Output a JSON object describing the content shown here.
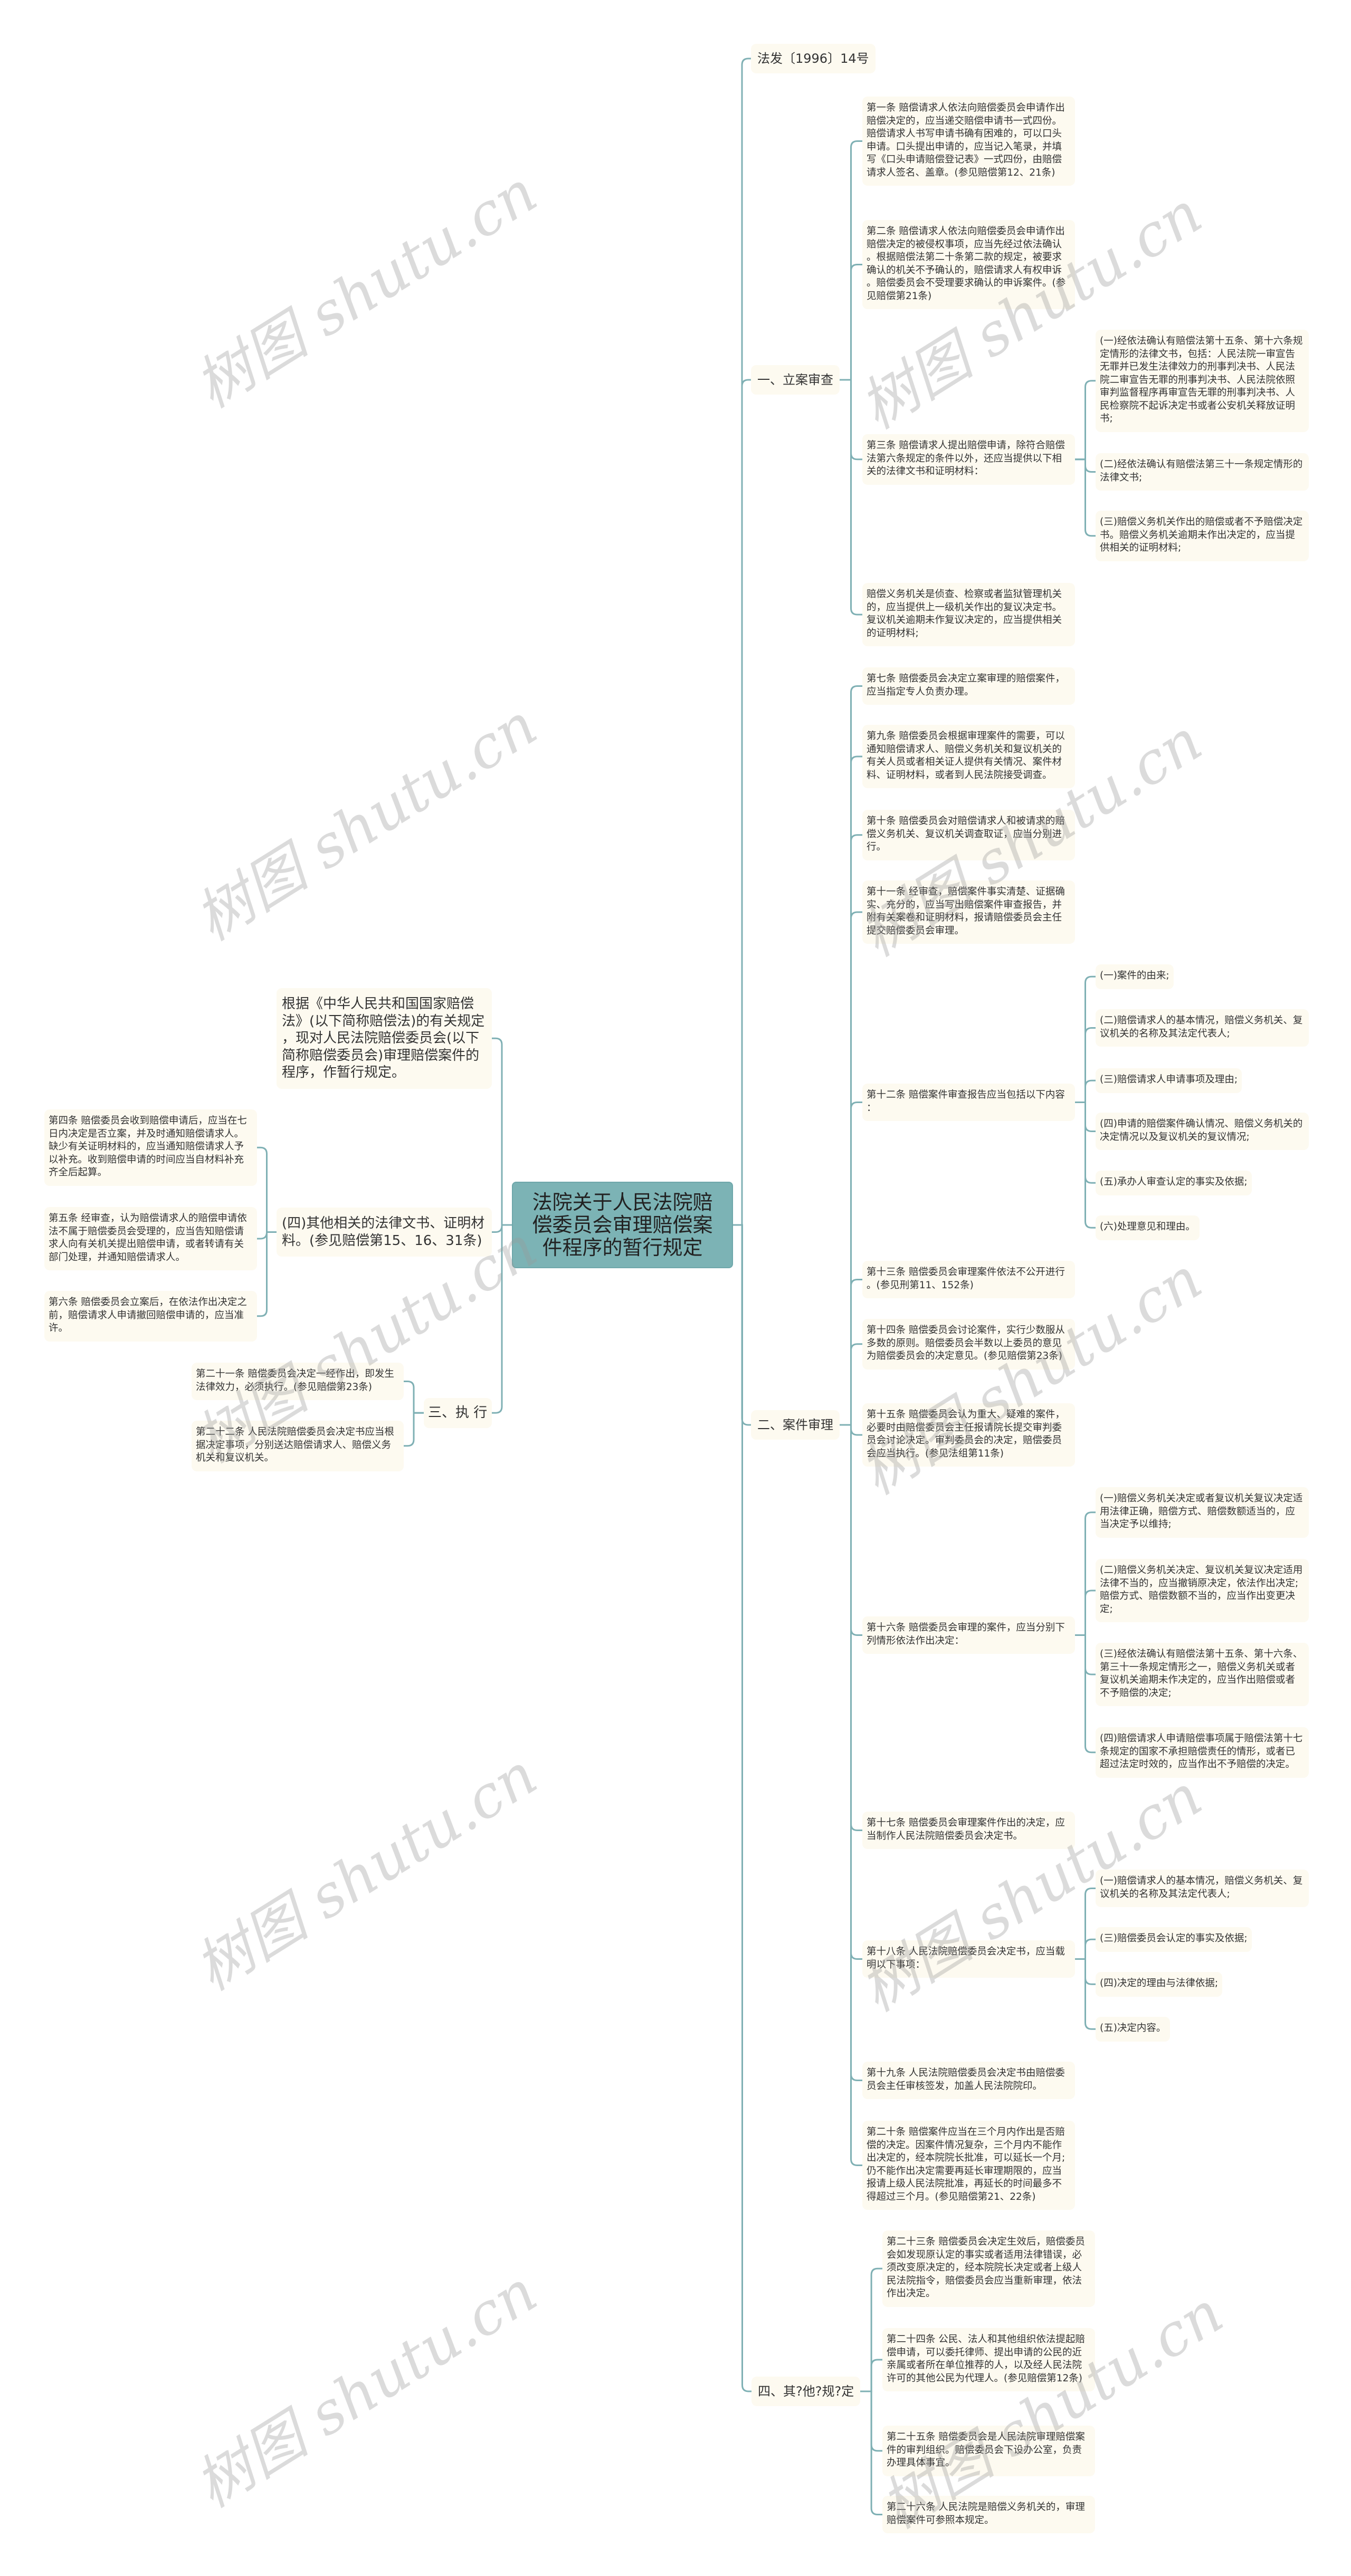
{
  "title": "法院关于人民法院赔偿委员会审理赔偿案件程序的暂行规定",
  "colors": {
    "root_fill": "#7cb3b5",
    "line": "#7fb0b4",
    "node_fill": "#fdfaf0"
  },
  "watermark": "树图 shutu.cn",
  "left": {
    "intro": "根据《中华人民共和国国家赔偿法》(以下简称赔偿法)的有关规定，现对人民法院赔偿委员会(以下简称赔偿委员会)审理赔偿案件的程序，作暂行规定。",
    "other_docs": {
      "label": "(四)其他相关的法律文书、证明材料。(参见赔偿第15、16、31条)",
      "items": [
        "第四条 赔偿委员会收到赔偿申请后，应当在七日内决定是否立案，并及时通知赔偿请求人。缺少有关证明材料的，应当通知赔偿请求人予以补充。收到赔偿申请的时间应当自材料补充齐全后起算。",
        "第五条 经审查，认为赔偿请求人的赔偿申请依法不属于赔偿委员会受理的，应当告知赔偿请求人向有关机关提出赔偿申请，或者转请有关部门处理，并通知赔偿请求人。",
        "第六条 赔偿委员会立案后，在依法作出决定之前，赔偿请求人申请撤回赔偿申请的，应当准许。"
      ]
    },
    "execution": {
      "label": "三、执 行",
      "items": [
        "第二十一条 赔偿委员会决定一经作出，即发生法律效力，必须执行。(参见赔偿第23条)",
        "第二十二条 人民法院赔偿委员会决定书应当根据决定事项，分别送达赔偿请求人、赔偿义务机关和复议机关。"
      ]
    }
  },
  "right": {
    "doc_number": "法发〔1996〕14号",
    "filing": {
      "label": "一、立案审查",
      "items": [
        {
          "text": "第一条 赔偿请求人依法向赔偿委员会申请作出赔偿决定的，应当递交赔偿申请书一式四份。赔偿请求人书写申请书确有困难的，可以口头申请。口头提出申请的，应当记入笔录，并填写《口头申请赔偿登记表》一式四份，由赔偿请求人签名、盖章。(参见赔偿第12、21条)"
        },
        {
          "text": "第二条 赔偿请求人依法向赔偿委员会申请作出赔偿决定的被侵权事项，应当先经过依法确认。根据赔偿法第二十条第二款的规定，被要求确认的机关不予确认的，赔偿请求人有权申诉。赔偿委员会不受理要求确认的申诉案件。(参见赔偿第21条)"
        },
        {
          "text": "第三条 赔偿请求人提出赔偿申请，除符合赔偿法第六条规定的条件以外，还应当提供以下相关的法律文书和证明材料：",
          "sub": [
            "(一)经依法确认有赔偿法第十五条、第十六条规定情形的法律文书，包括：人民法院一审宣告无罪并已发生法律效力的刑事判决书、人民法院二审宣告无罪的刑事判决书、人民法院依照审判监督程序再审宣告无罪的刑事判决书、人民检察院不起诉决定书或者公安机关释放证明书;",
            "(二)经依法确认有赔偿法第三十一条规定情形的法律文书;",
            "(三)赔偿义务机关作出的赔偿或者不予赔偿决定书。赔偿义务机关逾期未作出决定的，应当提供相关的证明材料;"
          ]
        },
        {
          "text": "赔偿义务机关是侦查、检察或者监狱管理机关的，应当提供上一级机关作出的复议决定书。复议机关逾期未作复议决定的，应当提供相关的证明材料;"
        }
      ]
    },
    "trial": {
      "label": "二、案件审理",
      "items": [
        {
          "text": "第七条 赔偿委员会决定立案审理的赔偿案件，应当指定专人负责办理。"
        },
        {
          "text": "第九条 赔偿委员会根据审理案件的需要，可以通知赔偿请求人、赔偿义务机关和复议机关的有关人员或者相关证人提供有关情况、案件材料、证明材料，或者到人民法院接受调查。"
        },
        {
          "text": "第十条 赔偿委员会对赔偿请求人和被请求的赔偿义务机关、复议机关调查取证，应当分别进行。"
        },
        {
          "text": "第十一条 经审查，赔偿案件事实清楚、证据确实、充分的，应当写出赔偿案件审查报告，并附有关案卷和证明材料，报请赔偿委员会主任提交赔偿委员会审理。"
        },
        {
          "text": "第十二条 赔偿案件审查报告应当包括以下内容：",
          "sub": [
            "(一)案件的由来;",
            "(二)赔偿请求人的基本情况，赔偿义务机关、复议机关的名称及其法定代表人;",
            "(三)赔偿请求人申请事项及理由;",
            "(四)申请的赔偿案件确认情况、赔偿义务机关的决定情况以及复议机关的复议情况;",
            "(五)承办人审查认定的事实及依据;",
            "(六)处理意见和理由。"
          ]
        },
        {
          "text": "第十三条 赔偿委员会审理案件依法不公开进行。(参见刑第11、152条)"
        },
        {
          "text": "第十四条 赔偿委员会讨论案件，实行少数服从多数的原则。赔偿委员会半数以上委员的意见为赔偿委员会的决定意见。(参见赔偿第23条)"
        },
        {
          "text": "第十五条 赔偿委员会认为重大、疑难的案件，必要时由赔偿委员会主任报请院长提交审判委员会讨论决定。审判委员会的决定，赔偿委员会应当执行。(参见法组第11条)"
        },
        {
          "text": "第十六条 赔偿委员会审理的案件，应当分别下列情形依法作出决定：",
          "sub": [
            "(一)赔偿义务机关决定或者复议机关复议决定适用法律正确，赔偿方式、赔偿数额适当的，应当决定予以维持;",
            "(二)赔偿义务机关决定、复议机关复议决定适用法律不当的，应当撤销原决定，依法作出决定;赔偿方式、赔偿数额不当的，应当作出变更决定;",
            "(三)经依法确认有赔偿法第十五条、第十六条、第三十一条规定情形之一，赔偿义务机关或者复议机关逾期未作决定的，应当作出赔偿或者不予赔偿的决定;",
            "(四)赔偿请求人申请赔偿事项属于赔偿法第十七条规定的国家不承担赔偿责任的情形，或者已超过法定时效的，应当作出不予赔偿的决定。"
          ]
        },
        {
          "text": "第十七条 赔偿委员会审理案件作出的决定，应当制作人民法院赔偿委员会决定书。"
        },
        {
          "text": "第十八条 人民法院赔偿委员会决定书，应当载明以下事项：",
          "sub": [
            "(一)赔偿请求人的基本情况，赔偿义务机关、复议机关的名称及其法定代表人;",
            "(三)赔偿委员会认定的事实及依据;",
            "(四)决定的理由与法律依据;",
            "(五)决定内容。"
          ]
        },
        {
          "text": "第十九条 人民法院赔偿委员会决定书由赔偿委员会主任审核签发，加盖人民法院院印。"
        },
        {
          "text": "第二十条 赔偿案件应当在三个月内作出是否赔偿的决定。因案件情况复杂，三个月内不能作出决定的，经本院院长批准，可以延长一个月;仍不能作出决定需要再延长审理期限的，应当报请上级人民法院批准，再延长的时间最多不得超过三个月。(参见赔偿第21、22条)"
        }
      ]
    },
    "other": {
      "label": "四、其?他?规?定",
      "items": [
        "第二十三条 赔偿委员会决定生效后，赔偿委员会如发现原认定的事实或者适用法律错误，必须改变原决定的，经本院院长决定或者上级人民法院指令，赔偿委员会应当重新审理，依法作出决定。",
        "第二十四条 公民、法人和其他组织依法提起赔偿申请，可以委托律师、提出申请的公民的近亲属或者所在单位推荐的人，以及经人民法院许可的其他公民为代理人。(参见赔偿第12条)",
        "第二十五条 赔偿委员会是人民法院审理赔偿案件的审判组织。赔偿委员会下设办公室，负责办理具体事宜。",
        "第二十六条 人民法院是赔偿义务机关的，审理赔偿案件可参照本规定。"
      ]
    }
  }
}
